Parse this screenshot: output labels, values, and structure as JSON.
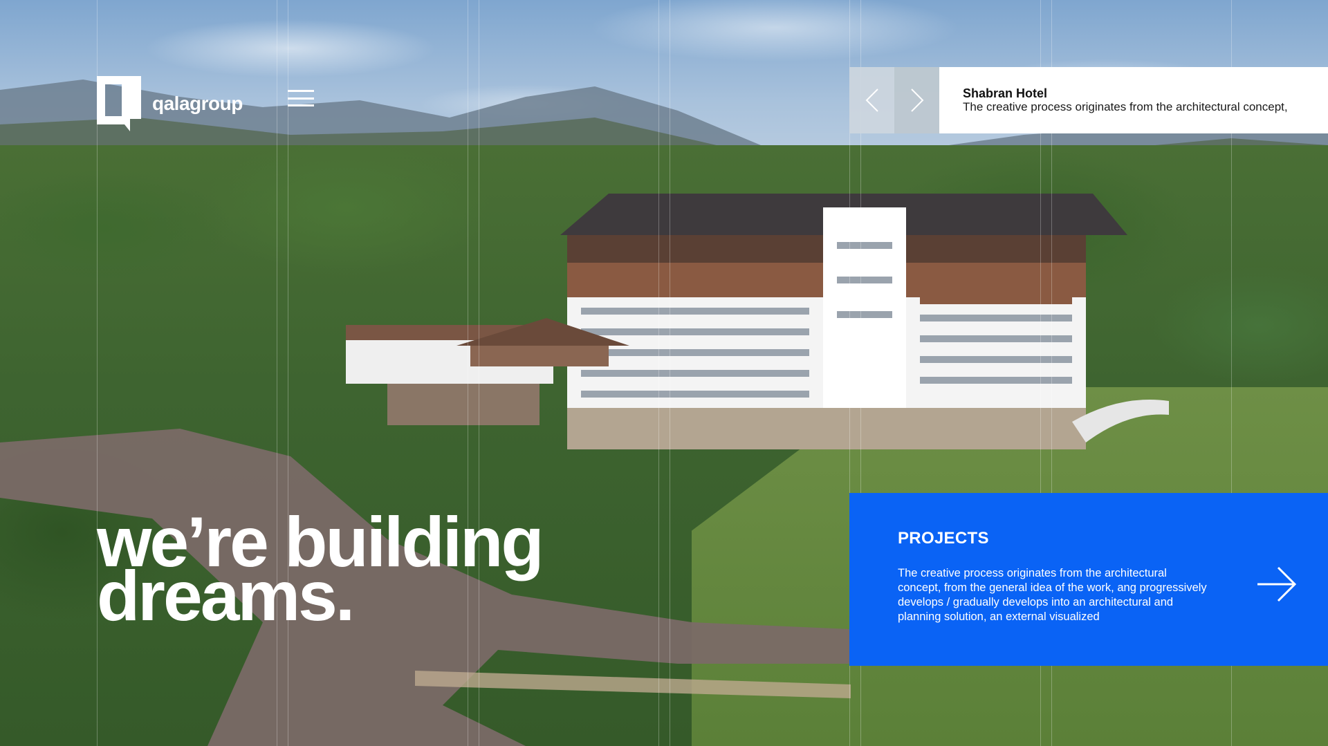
{
  "brand": {
    "name": "qalagroup",
    "logo_icon": "qala-logo-mark"
  },
  "header": {
    "menu_icon": "hamburger-menu-icon"
  },
  "slider": {
    "prev_icon": "chevron-left-icon",
    "next_icon": "chevron-right-icon",
    "project_title": "Shabran Hotel",
    "project_description": "The creative process originates from the architectural concept,"
  },
  "hero": {
    "line1": "we’re building",
    "line2": "dreams."
  },
  "projects": {
    "title": "PROJECTS",
    "description": "The creative process originates from the architectural concept, from the general idea of the work, ang progressively develops / gradually develops into an architectural and planning solution, an external visualized",
    "arrow_icon": "arrow-right-icon"
  },
  "colors": {
    "accent_blue": "#0a63f5",
    "white": "#ffffff",
    "slider_nav_bg": "#cdd6de"
  }
}
